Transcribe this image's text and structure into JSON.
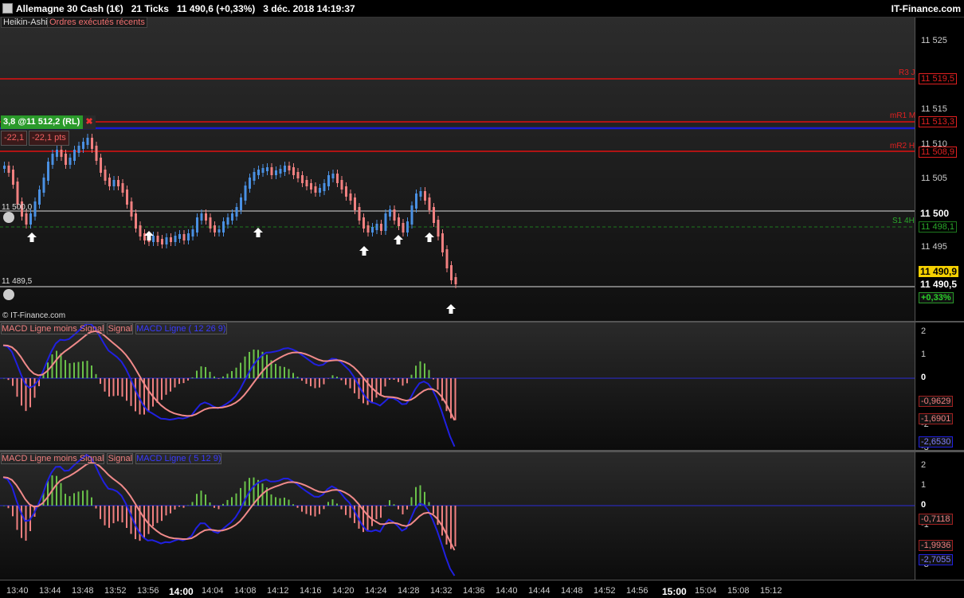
{
  "header": {
    "title": "Allemagne 30 Cash (1€)   21 Ticks   11 490,6 (+0,33%)   3 déc. 2018 14:19:37",
    "brand": "IT-Finance.com"
  },
  "tabs": {
    "heikin": "Heikin-Ashi",
    "orders": "Ordres exécutés récents"
  },
  "position": {
    "label": "3,8 @11 512,2 (RL)",
    "pl_value": "-22,1",
    "pl_pts": "-22,1 pts"
  },
  "levels": {
    "r3": "R3 J",
    "r3_val": "11 519,5",
    "mr1": "mR1 M",
    "mr1_val": "11 513,3",
    "mr2": "mR2 H",
    "mr2_val": "11 508,9",
    "s1": "S1 4H",
    "s1_val": "11 498,1",
    "line_a": "11 500,0",
    "line_a_axis": "11 500",
    "line_b": "11 489,5",
    "line_b_axis": "11 490,5",
    "current": "11 490,9",
    "change": "+0,33%"
  },
  "watermark": "© IT-Finance.com",
  "price_axis": [
    "11 525",
    "11 515",
    "11 510",
    "11 505",
    "11 495"
  ],
  "macd1": {
    "title_hist": "MACD Ligne moins Signal",
    "title_signal": "Signal",
    "title_line": "MACD Ligne ( 12 26 9)",
    "axis": [
      "2",
      "1",
      "0",
      "-1",
      "-2",
      "-3"
    ],
    "v_hist": "-0,9629",
    "v_signal": "-1,6901",
    "v_line": "-2,6530"
  },
  "macd2": {
    "title_hist": "MACD Ligne moins Signal",
    "title_signal": "Signal",
    "title_line": "MACD Ligne ( 5 12 9)",
    "axis": [
      "2",
      "1",
      "0",
      "-1",
      "-2",
      "-3"
    ],
    "v_hist": "-0,7118",
    "v_signal": "-1,9936",
    "v_line": "-2,7055"
  },
  "time_axis": [
    "13:40",
    "13:44",
    "13:48",
    "13:52",
    "13:56",
    "14:00",
    "14:04",
    "14:08",
    "14:12",
    "14:16",
    "14:20",
    "14:24",
    "14:28",
    "14:32",
    "14:36",
    "14:40",
    "14:44",
    "14:48",
    "14:52",
    "14:56",
    "15:00",
    "15:04",
    "15:08",
    "15:12"
  ],
  "colors": {
    "bull": "#4a90e2",
    "bear": "#f08080",
    "pivot": "#e01010",
    "blue_line": "#1a1ad0",
    "support": "#1e7a1e",
    "hist_pos": "#6ac24a",
    "hist_neg": "#f08080",
    "macd_line": "#2020e0",
    "signal": "#f08a8a"
  }
}
